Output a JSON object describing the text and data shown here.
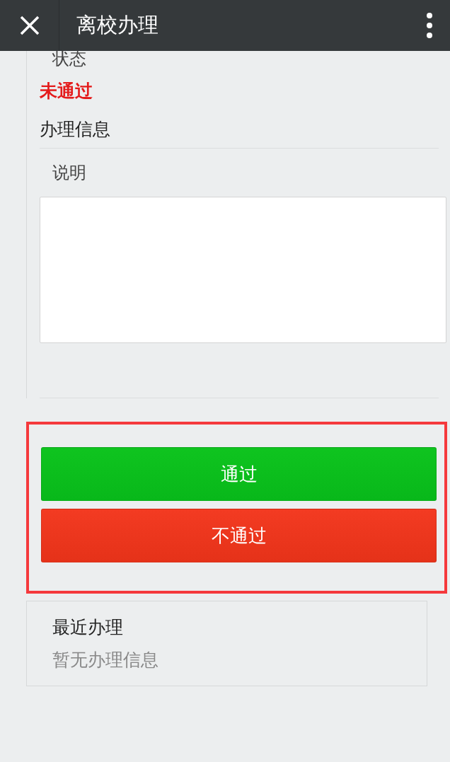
{
  "header": {
    "title": "离校办理"
  },
  "status": {
    "label": "状态",
    "value": "未通过"
  },
  "section": {
    "title": "办理信息",
    "note_label": "说明"
  },
  "actions": {
    "highlighted": true,
    "buttons": [
      {
        "kind": "approve",
        "label": "通过"
      },
      {
        "kind": "reject",
        "label": "不通过"
      }
    ]
  },
  "recent": {
    "title": "最近办理",
    "empty_text": "暂无办理信息"
  }
}
